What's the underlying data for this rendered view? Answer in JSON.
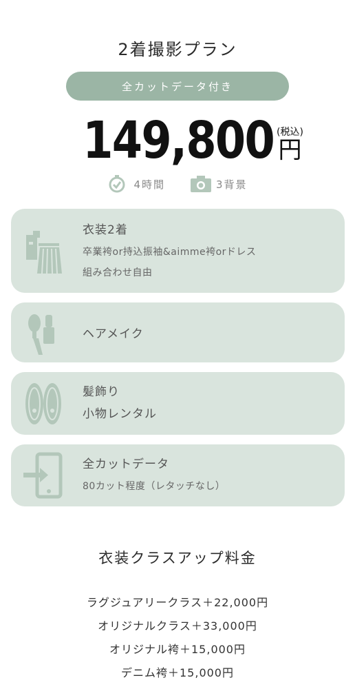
{
  "plan": {
    "title": "2着撮影プラン",
    "badge": "全カットデータ付き",
    "price": "149,800",
    "tax_label": "(税込)",
    "yen": "円",
    "duration_icon": "timer-icon",
    "duration": "4時間",
    "backgrounds_icon": "camera-icon",
    "backgrounds": "3背景"
  },
  "features": [
    {
      "icon": "kimono-icon",
      "title": "衣装2着",
      "lines": [
        "卒業袴or持込振袖&aimme袴orドレス",
        "組み合わせ自由"
      ]
    },
    {
      "icon": "makeup-brush-icon",
      "title": "ヘアメイク",
      "lines": []
    },
    {
      "icon": "sandals-icon",
      "title": "髪飾り",
      "lines": [
        "小物レンタル"
      ]
    },
    {
      "icon": "data-transfer-icon",
      "title": "全カットデータ",
      "lines": [
        "80カット程度（レタッチなし）"
      ]
    }
  ],
  "upgrade": {
    "title": "衣装クラスアップ料金",
    "items": [
      "ラグジュアリークラス＋22,000円",
      "オリジナルクラス＋33,000円",
      "オリジナル袴＋15,000円",
      "デニム袴＋15,000円"
    ]
  },
  "colors": {
    "badge": "#9bb5a5",
    "card": "#d9e4dd",
    "icon": "#b3c7ba",
    "text_dark": "#2b2b2b",
    "text_muted": "#888888"
  }
}
